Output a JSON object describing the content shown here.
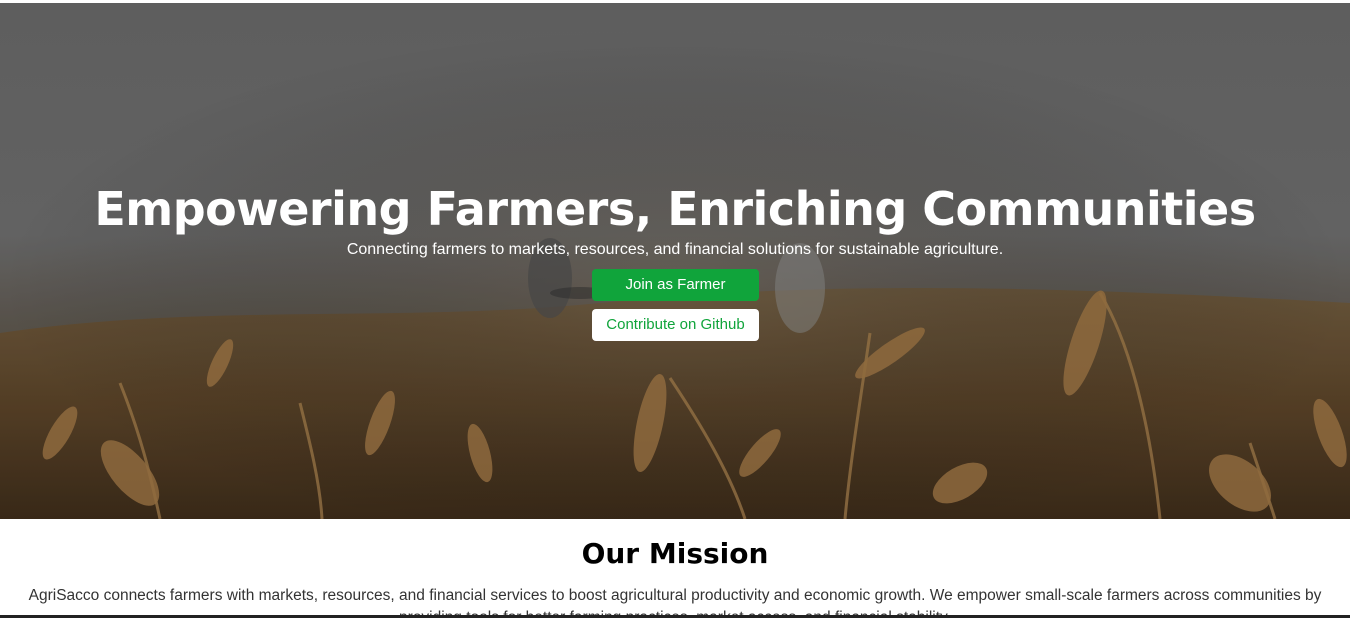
{
  "hero": {
    "title": "Empowering Farmers, Enriching Communities",
    "subtitle": "Connecting farmers to markets, resources, and financial solutions for sustainable agriculture.",
    "primary_button": "Join as Farmer",
    "secondary_button": "Contribute on Github",
    "background_image": "wheat-field-photo"
  },
  "mission": {
    "title": "Our Mission",
    "text": "AgriSacco connects farmers with markets, resources, and financial services to boost agricultural productivity and economic growth. We empower small-scale farmers across communities by providing tools for better farming practices, market access, and financial stability."
  },
  "colors": {
    "accent": "#10a43b",
    "hero_overlay": "#6a6a6a",
    "text_dark": "#333333"
  }
}
